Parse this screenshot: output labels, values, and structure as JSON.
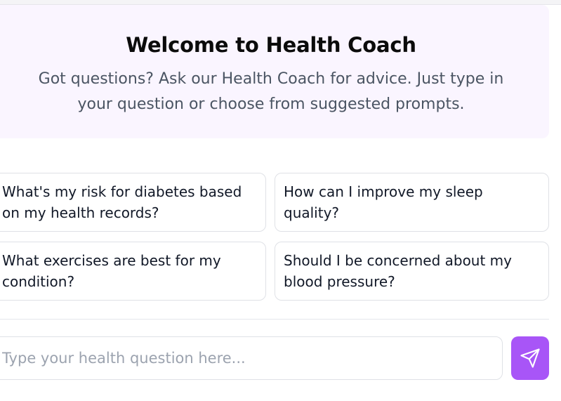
{
  "welcome": {
    "title": "Welcome to Health Coach",
    "description": "Got questions? Ask our Health Coach for advice. Just type in your question or choose from suggested prompts."
  },
  "prompts": [
    {
      "label": "What's my risk for diabetes based on my health records?"
    },
    {
      "label": "How can I improve my sleep quality?"
    },
    {
      "label": "What exercises are best for my condition?"
    },
    {
      "label": "Should I be concerned about my blood pressure?"
    }
  ],
  "chat": {
    "placeholder": "Type your health question here...",
    "value": "",
    "send_icon": "send-icon"
  },
  "colors": {
    "accent": "#a855f7",
    "welcome_background": "#faf5ff",
    "muted_text": "#4b5563",
    "placeholder_text": "#9ca3af"
  }
}
